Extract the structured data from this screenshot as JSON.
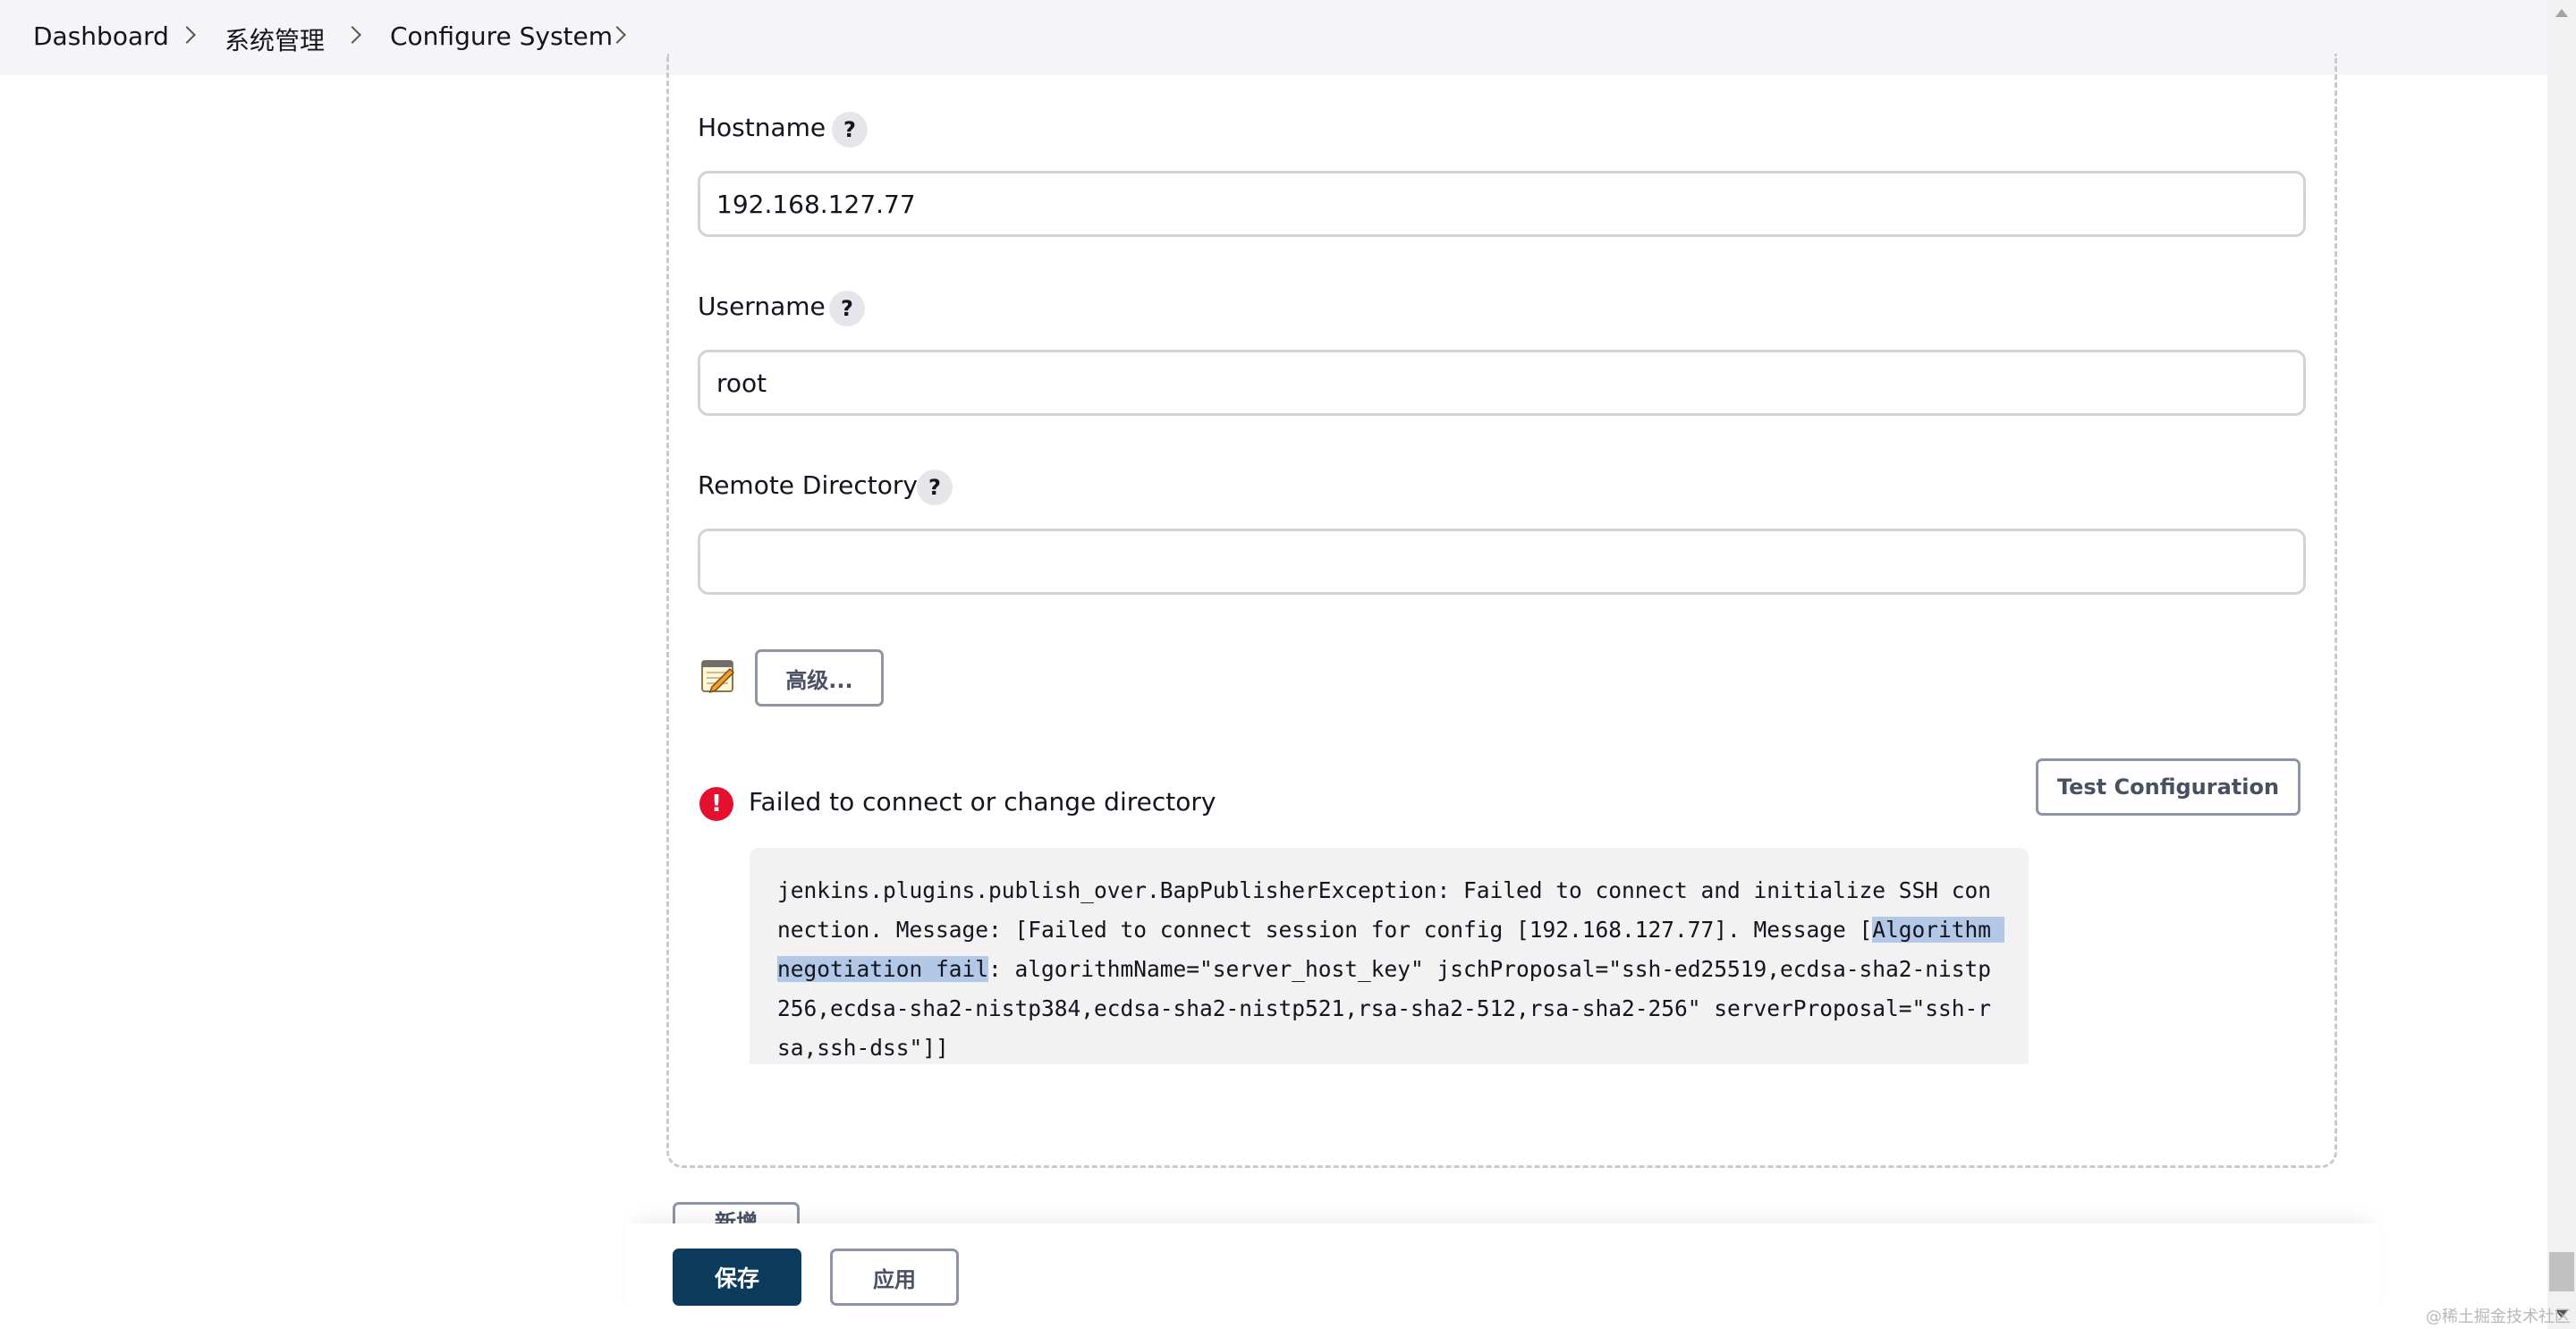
{
  "breadcrumb": {
    "items": [
      "Dashboard",
      "系统管理",
      "Configure System"
    ]
  },
  "form": {
    "hostname": {
      "label": "Hostname",
      "value": "192.168.127.77"
    },
    "username": {
      "label": "Username",
      "value": "root"
    },
    "remote_directory": {
      "label": "Remote Directory",
      "value": ""
    },
    "help_glyph": "?",
    "advanced_label": "高级...",
    "test_config_label": "Test Configuration"
  },
  "error": {
    "icon_glyph": "!",
    "title": "Failed to connect or change directory",
    "message_before": "jenkins.plugins.publish_over.BapPublisherException: Failed to connect and initialize SSH connection. Message: [Failed to connect session for config [192.168.127.77]. Message [",
    "message_highlight": "Algorithm negotiation fail",
    "message_after": ": algorithmName=\"server_host_key\" jschProposal=\"ssh-ed25519,ecdsa-sha2-nistp256,ecdsa-sha2-nistp384,ecdsa-sha2-nistp521,rsa-sha2-512,rsa-sha2-256\" serverProposal=\"ssh-rsa,ssh-dss\"]]"
  },
  "bottom": {
    "partial_button_label": "新增",
    "save_label": "保存",
    "apply_label": "应用"
  },
  "watermark": "@稀土掘金技术社区",
  "colors": {
    "primary": "#0d3b5e",
    "error": "#e3112e",
    "highlight": "#b3c7e6"
  }
}
